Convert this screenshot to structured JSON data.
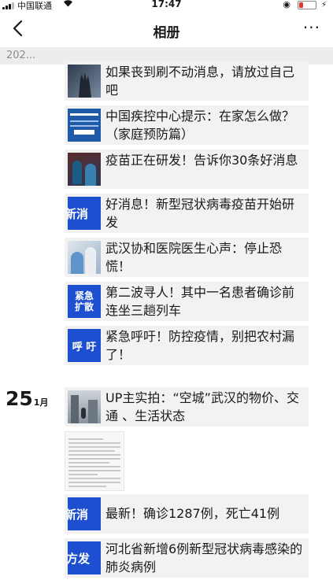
{
  "status": {
    "carrier": "中国联通",
    "time": "17:47"
  },
  "nav": {
    "title": "相册",
    "more": "···"
  },
  "year": "202...",
  "posts": [
    {
      "text": "如果丧到刷不动消息，请放过自己吧"
    },
    {
      "text": "中国疾控中心提示：在家怎么做？（家庭预防篇）"
    },
    {
      "text": "疫苗正在研发！告诉你30条好消息"
    },
    {
      "text": "好消息！新型冠状病毒疫苗开始研发",
      "thumb": "新消"
    },
    {
      "text": "武汉协和医院医生心声：停止恐慌！"
    },
    {
      "text": "第二波寻人！其中一名患者确诊前连坐三趟列车",
      "thumb": "紧急扩散"
    },
    {
      "text": "紧急呼吁！防控疫情，别把农村漏了！",
      "thumb": "呼 吁"
    }
  ],
  "date": {
    "day": "25",
    "month": "1月"
  },
  "posts2": [
    {
      "text": "UP主实拍：“空城”武汉的物价、交通 、生活状态"
    },
    {
      "text": "最新！确诊1287例，死亡41例",
      "thumb": "新消"
    },
    {
      "text": "河北省新增6例新型冠状病毒感染的肺炎病例",
      "thumb": "方发"
    }
  ]
}
